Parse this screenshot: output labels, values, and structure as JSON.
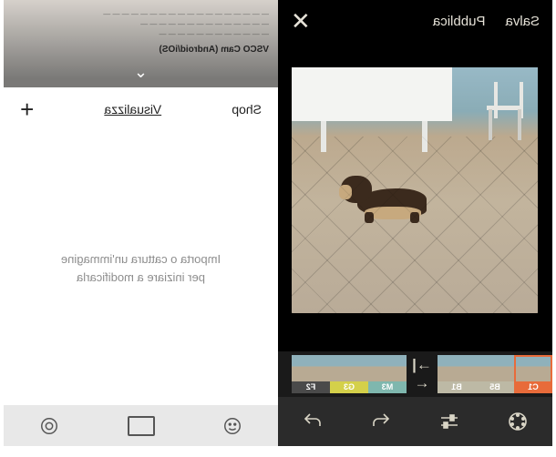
{
  "editor": {
    "save_label": "Salva",
    "publish_label": "Pubblica",
    "close_label": "✕",
    "filter_divider": "→|←",
    "filters": [
      {
        "name": "C1",
        "color": "#e86b3a",
        "selected": true
      },
      {
        "name": "B5",
        "color": "#bdb9a5"
      },
      {
        "name": "B1",
        "color": "#bdb9a5"
      },
      {
        "name": "M3",
        "color": "#7fb7ae"
      },
      {
        "name": "G3",
        "color": "#d4d04a"
      },
      {
        "name": "F2",
        "color": "#4a4a4a"
      }
    ],
    "tools": {
      "filters_icon": "filters-dial",
      "adjust_icon": "sliders",
      "undo_icon": "undo",
      "redo_icon": "redo"
    }
  },
  "gallery": {
    "preview_heading": "VSCO Cam (Android/iOS)",
    "chevron": "⌄",
    "tabs": {
      "shop": "Shop",
      "view": "Visualizza",
      "add": "+"
    },
    "empty_line1": "Importa o cattura un'immagine",
    "empty_line2": "per iniziare a modificarla",
    "bottom": {
      "smile_icon": "smile",
      "gallery_icon": "gallery-rect",
      "camera_icon": "camera-circle"
    }
  }
}
